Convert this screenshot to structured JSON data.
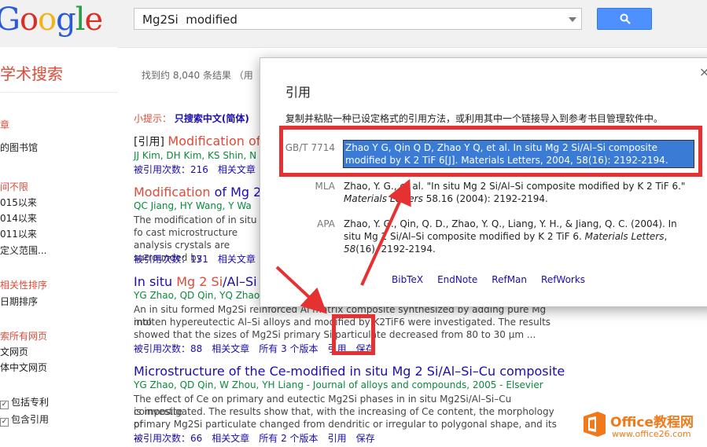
{
  "header": {
    "logo": "Google",
    "search_value": "Mg2Si  modified",
    "search_button_icon": "search-icon"
  },
  "sidebar": {
    "title": "学术搜索",
    "items": [
      {
        "label": "章",
        "style": "red"
      },
      {
        "label": "的图书馆",
        "style": "plain"
      },
      {
        "label": "间不限",
        "style": "red"
      },
      {
        "label": "015以来",
        "style": "plain"
      },
      {
        "label": "014以来",
        "style": "plain"
      },
      {
        "label": "011以来",
        "style": "plain"
      },
      {
        "label": "定义范围...",
        "style": "plain"
      },
      {
        "label": "相关性排序",
        "style": "red"
      },
      {
        "label": "日期排序",
        "style": "plain"
      },
      {
        "label": "索所有网页",
        "style": "red"
      },
      {
        "label": "文网页",
        "style": "plain"
      },
      {
        "label": "体中文网页",
        "style": "plain"
      },
      {
        "label": "包括专利",
        "style": "check"
      },
      {
        "label": "包含引用",
        "style": "check"
      }
    ]
  },
  "main": {
    "stats": "找到约 8,040 条结果 （用",
    "tip_prefix": "小提示：",
    "tip_text": "只搜索中文(简体)",
    "results": [
      {
        "tag": "[引用]",
        "title": "Modification of M",
        "authors": "JJ Kim, DH Kim, KS Shin, N",
        "snippet": "",
        "links": [
          "被引用次数：216",
          "相关文章"
        ]
      },
      {
        "tag": "",
        "title_pre": "Modification",
        "title_post": " of Mg 2",
        "authors": "QC Jiang, HY Wang, Y Wa",
        "snippet": "The modification of in situ fo cast microstructure analysis crystals are surrounded by",
        "links": [
          "被引用次数：131",
          "相关文章"
        ]
      },
      {
        "title_pre": "In situ ",
        "title_hl": "Mg 2 Si",
        "title_post": "/Al–Si c",
        "authors": "YG Zhao, QD Qin, YQ Zhao",
        "snippet_1": "An in situ formed Mg2Si reinforced Al matrix composite synthesized by adding pure Mg into",
        "snippet_2": "molten hypereutectic Al–Si alloys and modified by K2TiF6 were investigated. The results",
        "snippet_3": "showed that the sizes of Mg2Si primary Si particulate decreased from 80 to 30 μm ...",
        "links": [
          "被引用次数：88",
          "相关文章",
          "所有 3 个版本",
          "引用",
          "保存"
        ]
      },
      {
        "title": "Microstructure of the Ce-modified in situ Mg 2 Si/Al–Si–Cu composite",
        "authors": "YG Zhao, QD Qin, W Zhou, YH Liang - Journal of alloys and compounds, 2005 - Elsevier",
        "snippet_1": "The effect of Ce on primary and eutectic Mg2Si phases in in situ Mg2Si/Al–Si–Cu composite",
        "snippet_2": "is investigated. The results show that, with the increasing of Ce content, the morphology of",
        "snippet_3": "primary Mg2Si particulate changed from dendritic or irregular to polygonal shape, and its ...",
        "links": [
          "被引用次数：66",
          "相关文章",
          "所有 2 个版本",
          "引用",
          "保存"
        ]
      }
    ]
  },
  "dialog": {
    "title": "引用",
    "close": "×",
    "description": "复制并粘贴一种已设定格式的引用方法，或利用其中一个链接导入到参考书目管理软件中。",
    "citations": [
      {
        "label": "GB/T 7714",
        "text": "Zhao Y G, Qin Q D, Zhao Y Q, et al. In situ Mg 2 Si/Al–Si composite modified by K 2 TiF 6[J]. Materials Letters, 2004, 58(16): 2192-2194."
      },
      {
        "label": "MLA",
        "text_a": "Zhao, Y. G., et al. \"In situ Mg 2 Si/Al–Si composite modified by K 2 TiF 6.\"",
        "text_b_italic": "Materials Letters",
        "text_b": " 58.16 (2004): 2192-2194."
      },
      {
        "label": "APA",
        "text_a": "Zhao, Y. G., Qin, Q. D., Zhao, Y. Q., Liang, Y. H., & Jiang, Q. C. (2004). In situ Mg 2 Si/Al–Si composite modified by K 2 TiF 6. ",
        "text_b_italic": "Materials Letters",
        "text_b": ", ",
        "text_c_italic": "58",
        "text_c": "(16), 2192-2194."
      }
    ],
    "export_links": [
      "BibTeX",
      "EndNote",
      "RefMan",
      "RefWorks"
    ]
  },
  "watermark": {
    "title": "Office教程网",
    "url": "www.office26.com"
  },
  "colors": {
    "accent_red": "#dd4b39",
    "link_blue": "#1a0dab",
    "author_green": "#0a8a3a",
    "highlight_blue": "#3a7bd5",
    "annotation_red": "#e53131",
    "watermark_orange": "#f07a1b"
  }
}
